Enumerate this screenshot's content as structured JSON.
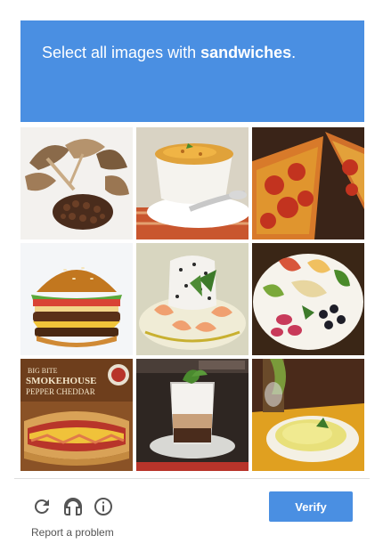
{
  "header": {
    "instruction_prefix": "Select all images with ",
    "instruction_target": "sandwiches",
    "instruction_suffix": ".",
    "background_color": "#4a8fe2"
  },
  "tiles": [
    {
      "name": "mushrooms-and-beans"
    },
    {
      "name": "soup-bowl"
    },
    {
      "name": "pizza-slices"
    },
    {
      "name": "burger"
    },
    {
      "name": "shrimp-rice-dish"
    },
    {
      "name": "salad-plate"
    },
    {
      "name": "smokehouse-sandwich",
      "poster_line1": "SMOKEHOUSE",
      "poster_line2": "PEPPER CHEDDAR"
    },
    {
      "name": "coffee-dessert-glass"
    },
    {
      "name": "yellow-rice-dish"
    }
  ],
  "footer": {
    "reload_icon": "reload-icon",
    "audio_icon": "headphones-icon",
    "info_icon": "info-icon",
    "report_label": "Report a problem",
    "verify_label": "Verify",
    "verify_color": "#4a8fe2"
  }
}
